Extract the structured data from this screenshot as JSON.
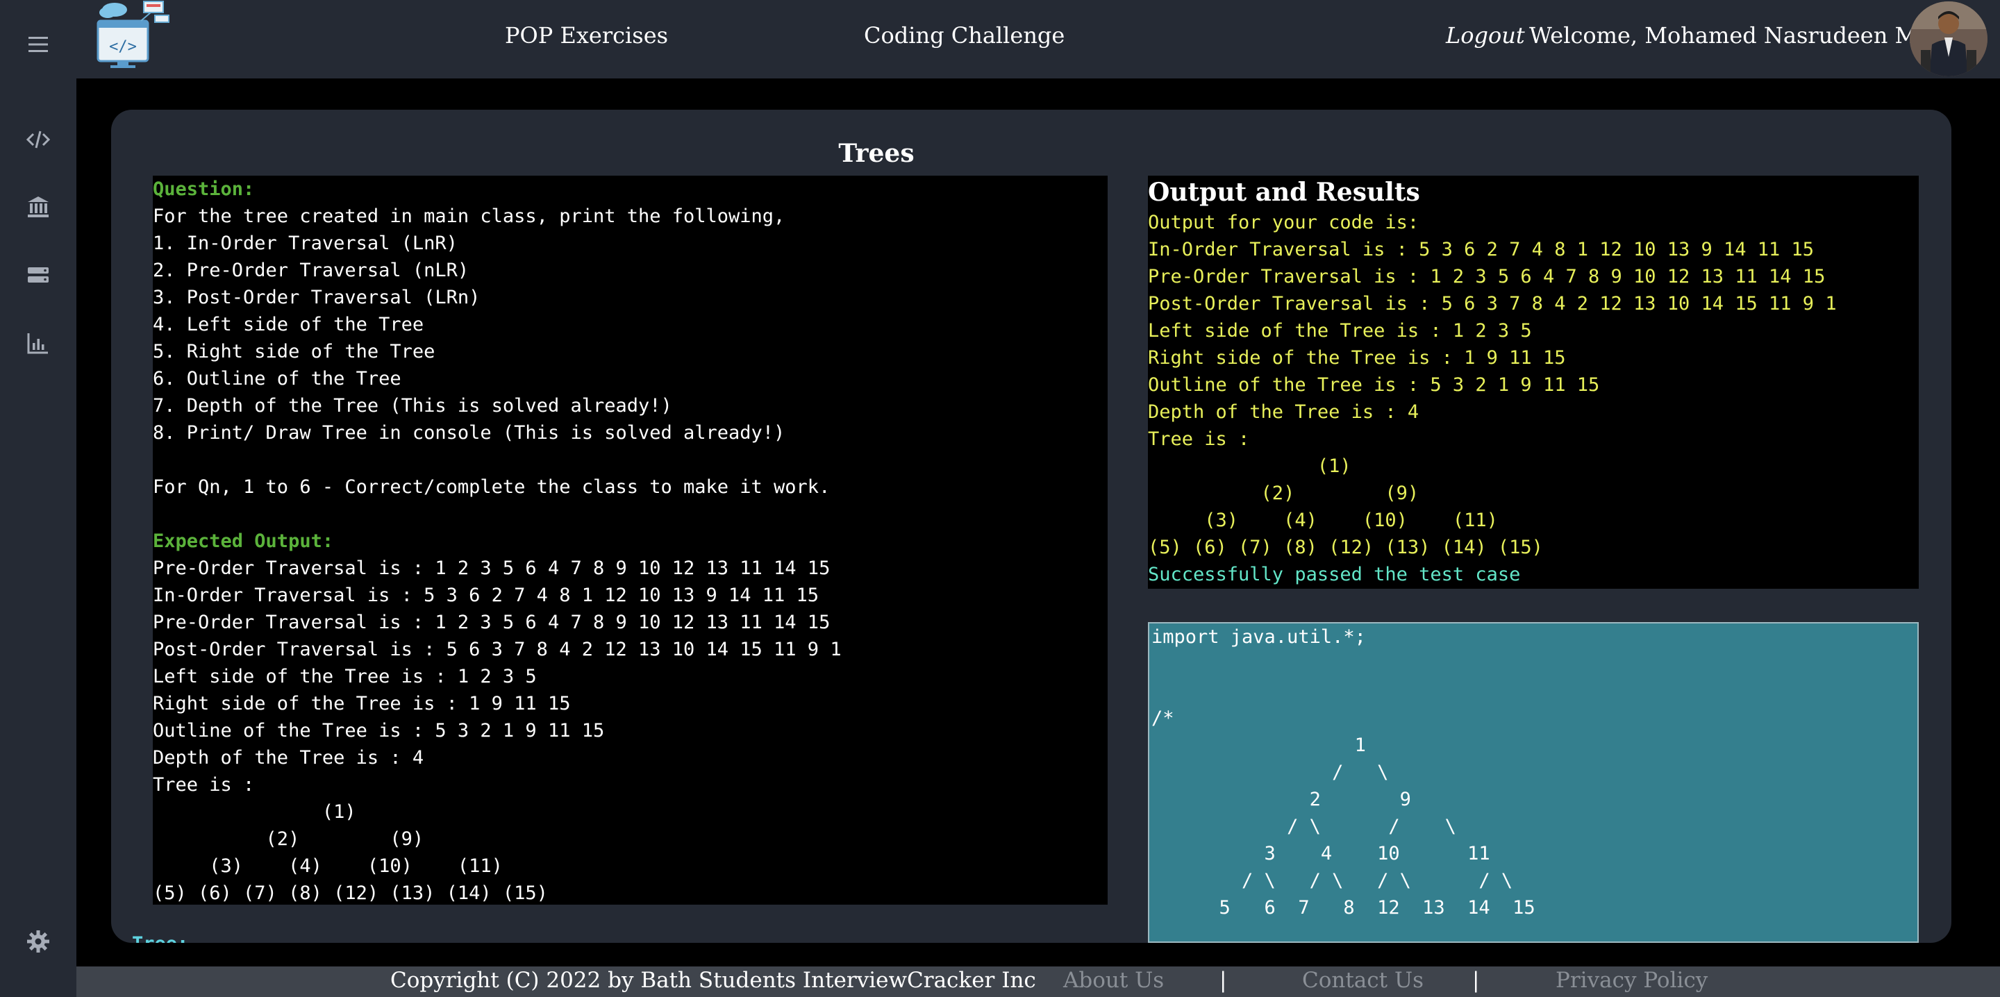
{
  "nav": {
    "pop_exercises": "POP Exercises",
    "coding_challenge": "Coding Challenge",
    "logout": "Logout",
    "welcome": "Welcome, Mohamed Nasrudeen Meeran"
  },
  "sidebar": {
    "icons": [
      "menu-icon",
      "code-icon",
      "bank-icon",
      "database-icon",
      "chart-icon",
      "gear-icon"
    ]
  },
  "card": {
    "title": "Trees"
  },
  "question": {
    "heading": "Question:",
    "lines": [
      "For the tree created in main class, print the following,",
      "1. In-Order Traversal (LnR)",
      "2. Pre-Order Traversal (nLR)",
      "3. Post-Order Traversal (LRn)",
      "4. Left side of the Tree",
      "5. Right side of the Tree",
      "6. Outline of the Tree",
      "7. Depth of the Tree (This is solved already!)",
      "8. Print/ Draw Tree in console (This is solved already!)",
      "",
      "For Qn, 1 to 6 - Correct/complete the class to make it work.",
      ""
    ],
    "expected_heading": "Expected Output:",
    "expected_lines": [
      "Pre-Order Traversal is : 1 2 3 5 6 4 7 8 9 10 12 13 11 14 15",
      "In-Order Traversal is : 5 3 6 2 7 4 8 1 12 10 13 9 14 11 15",
      "Pre-Order Traversal is : 1 2 3 5 6 4 7 8 9 10 12 13 11 14 15",
      "Post-Order Traversal is : 5 6 3 7 8 4 2 12 13 10 14 15 11 9 1",
      "Left side of the Tree is : 1 2 3 5",
      "Right side of the Tree is : 1 9 11 15",
      "Outline of the Tree is : 5 3 2 1 9 11 15",
      "Depth of the Tree is : 4",
      "Tree is :",
      "               (1)",
      "          (2)        (9)",
      "     (3)    (4)    (10)    (11)",
      "(5) (6) (7) (8) (12) (13) (14) (15)"
    ]
  },
  "output": {
    "title": "Output and Results",
    "lines": [
      "Output for your code is:",
      "In-Order Traversal is : 5 3 6 2 7 4 8 1 12 10 13 9 14 11 15",
      "Pre-Order Traversal is : 1 2 3 5 6 4 7 8 9 10 12 13 11 14 15",
      "Post-Order Traversal is : 5 6 3 7 8 4 2 12 13 10 14 15 11 9 1",
      "Left side of the Tree is : 1 2 3 5",
      "Right side of the Tree is : 1 9 11 15",
      "Outline of the Tree is : 5 3 2 1 9 11 15",
      "Depth of the Tree is : 4",
      "Tree is :",
      "               (1)",
      "          (2)        (9)",
      "     (3)    (4)    (10)    (11)",
      "(5) (6) (7) (8) (12) (13) (14) (15)"
    ],
    "success": "Successfully passed the test case"
  },
  "editor": {
    "lines": [
      "import java.util.*;",
      "",
      "",
      "/*",
      "                  1",
      "                /   \\",
      "              2       9",
      "            / \\      /    \\",
      "          3    4    10      11",
      "        / \\   / \\   / \\      / \\",
      "      5   6  7   8  12  13  14  15"
    ]
  },
  "peek": "Tree:",
  "footer": {
    "copyright": "Copyright (C) 2022 by Bath Students InterviewCracker Inc",
    "about": "About Us",
    "contact": "Contact Us",
    "privacy": "Privacy Policy",
    "separator": "|"
  },
  "colors": {
    "sidebar_bg": "#252a34",
    "card_bg": "#252a34",
    "editor_bg": "#347f8e",
    "question_heading": "#5bb33b",
    "output_text": "#e8f05a",
    "success_text": "#63e6c8"
  }
}
